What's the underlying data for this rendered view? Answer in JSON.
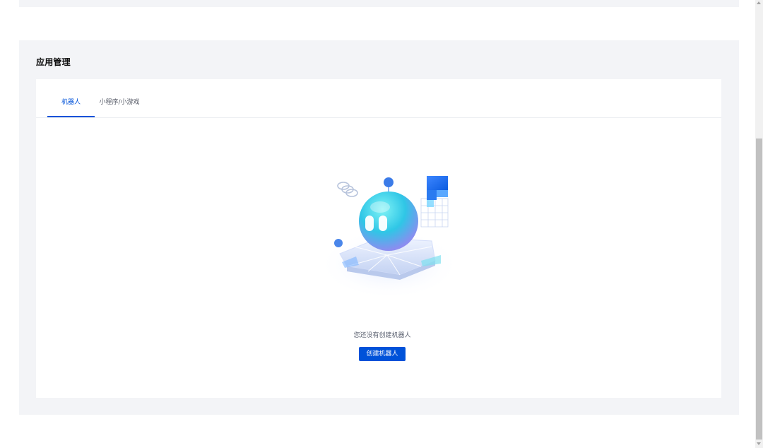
{
  "section": {
    "title": "应用管理"
  },
  "tabs": [
    {
      "label": "机器人",
      "active": true
    },
    {
      "label": "小程序/小游戏",
      "active": false
    }
  ],
  "empty_state": {
    "icon": "robot-illustration-icon",
    "message": "您还没有创建机器人",
    "button_label": "创建机器人"
  },
  "colors": {
    "accent": "#0052d9",
    "section_bg": "#f3f4f7",
    "panel_bg": "#ffffff"
  }
}
